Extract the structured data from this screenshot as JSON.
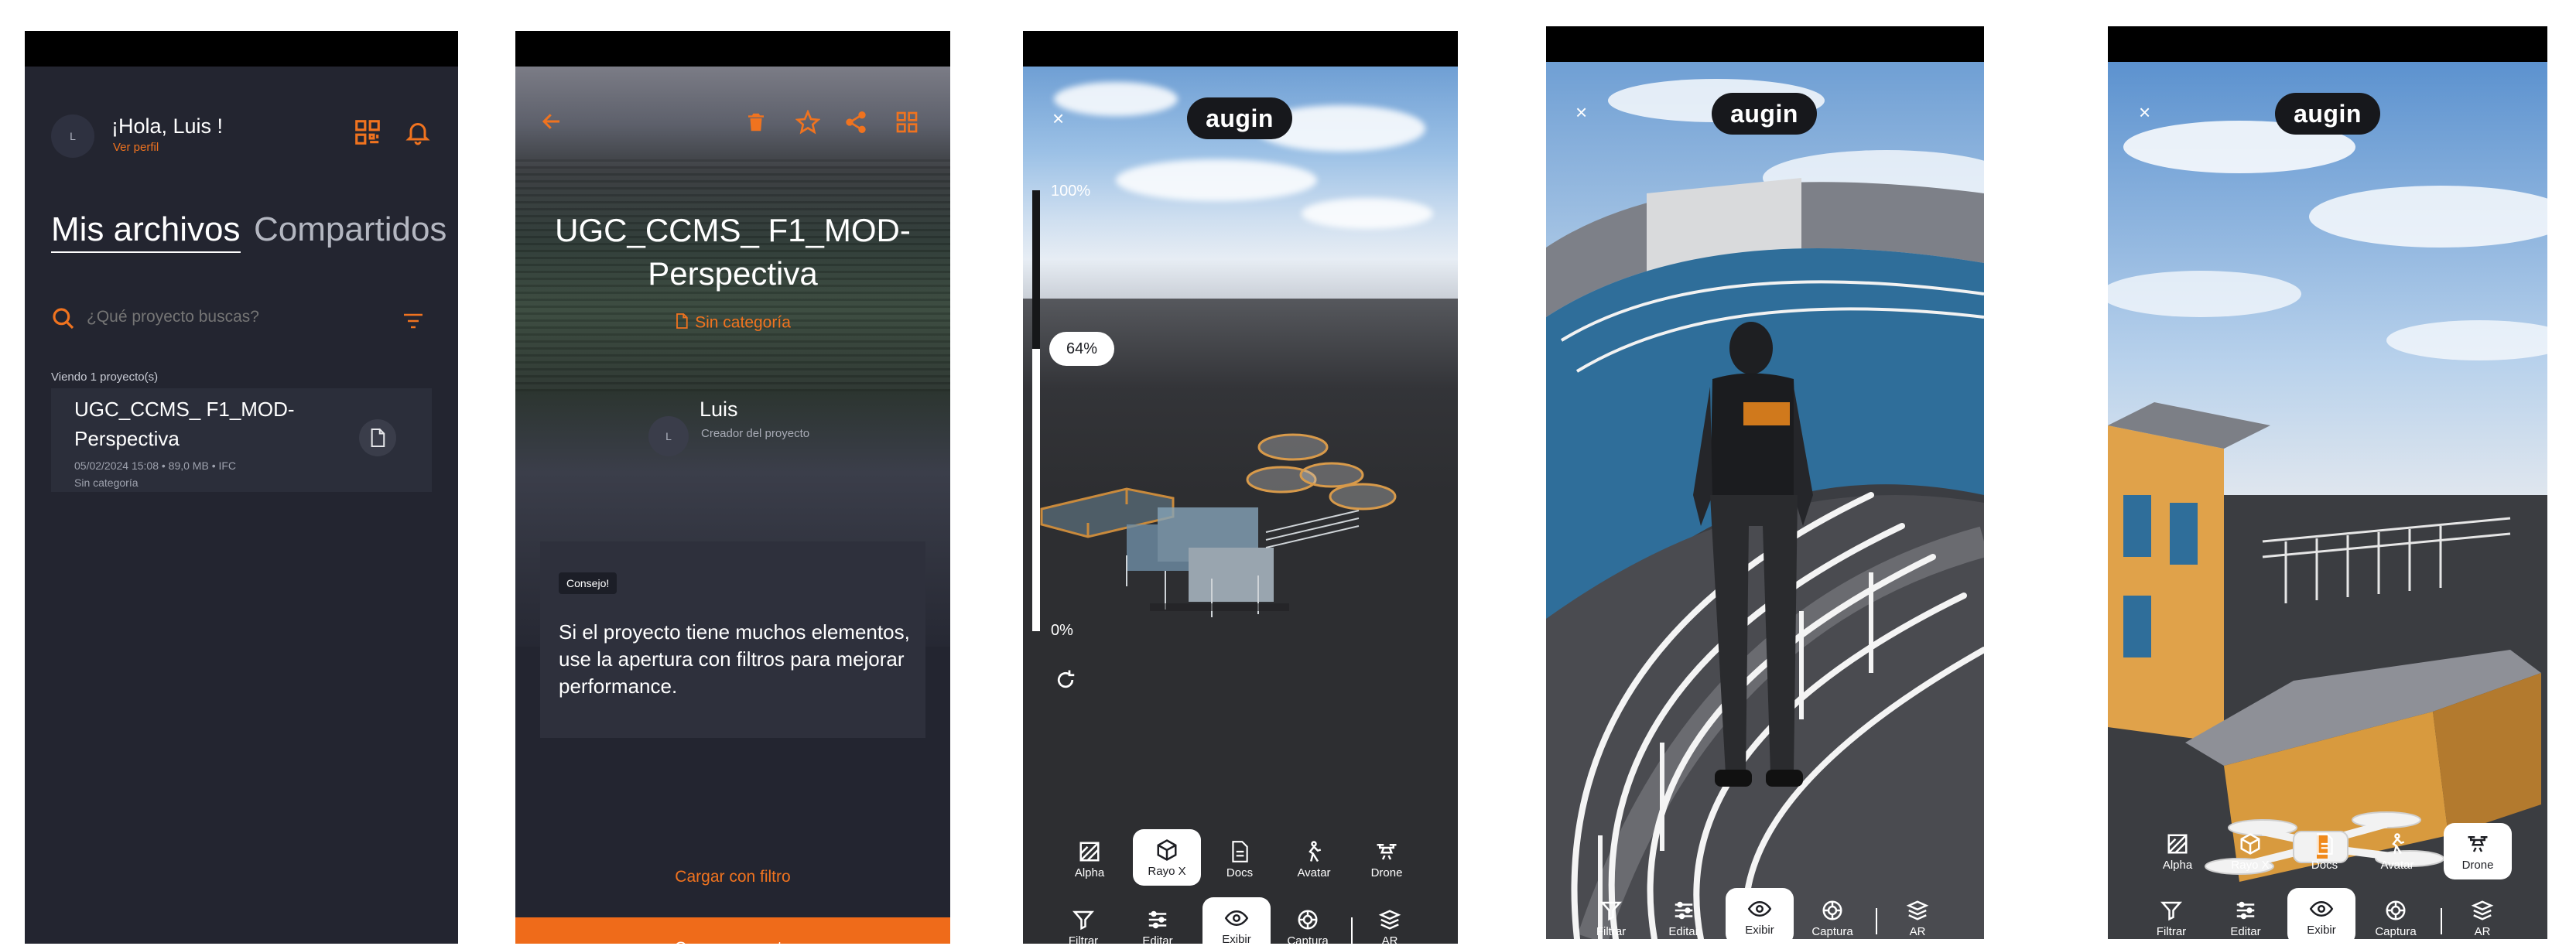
{
  "brand": {
    "accent": "#f0731f",
    "panel_dark": "#232530",
    "logo_text": "augin"
  },
  "screen1": {
    "avatar_initial": "L",
    "greeting": "¡Hola, Luis !",
    "profile_link": "Ver perfil",
    "tabs": [
      "Mis archivos",
      "Compartidos"
    ],
    "search_placeholder": "¿Qué proyecto buscas?",
    "results_count": "Viendo 1 proyecto(s)",
    "project": {
      "title": "UGC_CCMS_ F1_MOD-Perspectiva",
      "meta": "05/02/2024 15:08 • 89,0 MB • IFC",
      "category": "Sin categoría"
    },
    "icons": [
      "qr-scan-icon",
      "bell-icon",
      "search-icon",
      "filter-icon",
      "document-icon"
    ]
  },
  "screen2": {
    "title": "UGC_CCMS_ F1_MOD-Perspectiva",
    "category": "Sin categoría",
    "creator_initial": "L",
    "creator_name": "Luis",
    "creator_role": "Creador del proyecto",
    "tip_badge": "Consejo!",
    "tip_text": "Si el proyecto tiene muchos elementos, use la apertura con filtros para mejorar performance.",
    "filter_link": "Cargar con filtro",
    "load_button": "Cargar proyecto",
    "icons": [
      "back-arrow-icon",
      "trash-icon",
      "star-icon",
      "share-icon",
      "grid-icon"
    ]
  },
  "viewer": {
    "close": "×",
    "logo": "augin",
    "top_tools": [
      "Alpha",
      "Rayo X",
      "Docs",
      "Avatar",
      "Drone"
    ],
    "bottom_tools": [
      "Filtrar",
      "Editar",
      "Exibir",
      "Captura",
      "AR"
    ]
  },
  "screen3": {
    "slider_max": "100%",
    "slider_min": "0%",
    "slider_value": "64%",
    "slider_fraction": 0.64,
    "active_top_tool": "Rayo X",
    "active_bottom_tool": "Exibir"
  },
  "screen4": {
    "mode": "Avatar",
    "active_bottom_tool": "Exibir"
  },
  "screen5": {
    "active_top_tool": "Drone",
    "active_bottom_tool": "Exibir"
  }
}
